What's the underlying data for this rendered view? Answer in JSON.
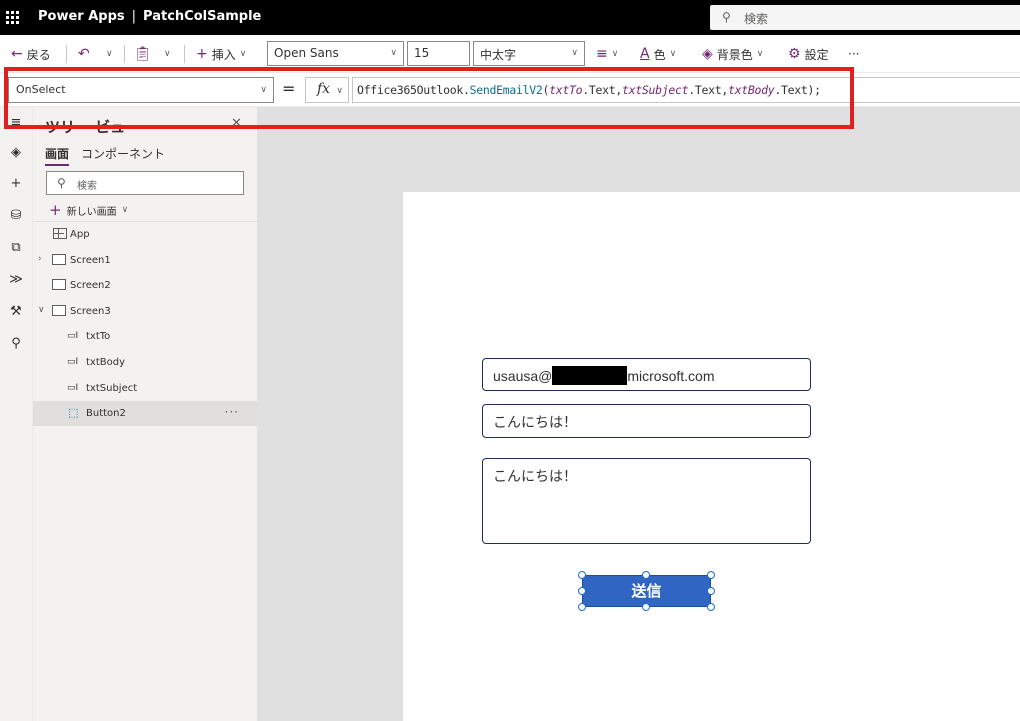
{
  "titlebar": {
    "product": "Power Apps",
    "separator": "|",
    "app_name": "PatchColSample",
    "search_placeholder": "検索"
  },
  "commandbar": {
    "back": "戻る",
    "insert": "挿入",
    "font_family": "Open Sans",
    "font_size": "15",
    "font_weight": "中太字",
    "color": "色",
    "background_color": "背景色",
    "settings": "設定",
    "more": "···"
  },
  "formulabar": {
    "property": "OnSelect",
    "equals": "=",
    "fx": "fx",
    "formula_parts": [
      "Office365Outlook.",
      "SendEmailV2",
      "(",
      "txtTo",
      ".Text,",
      "txtSubject",
      ".Text,",
      "txtBody",
      ".Text);"
    ]
  },
  "treeview": {
    "title": "ツリー ビュー",
    "tabs": [
      "画面",
      "コンポーネント"
    ],
    "search_placeholder": "検索",
    "new_screen": "新しい画面",
    "nodes": [
      "App",
      "Screen1",
      "Screen2",
      "Screen3",
      "txtTo",
      "txtBody",
      "txtSubject",
      "Button2"
    ]
  },
  "canvas": {
    "to_prefix": "usausa@",
    "to_suffix": "microsoft.com",
    "subject": "こんにちは！",
    "body": "こんにちは！",
    "button": "送信"
  },
  "colors": {
    "accent": "#742774",
    "button": "#3165c2",
    "highlight": "#e0201f"
  }
}
